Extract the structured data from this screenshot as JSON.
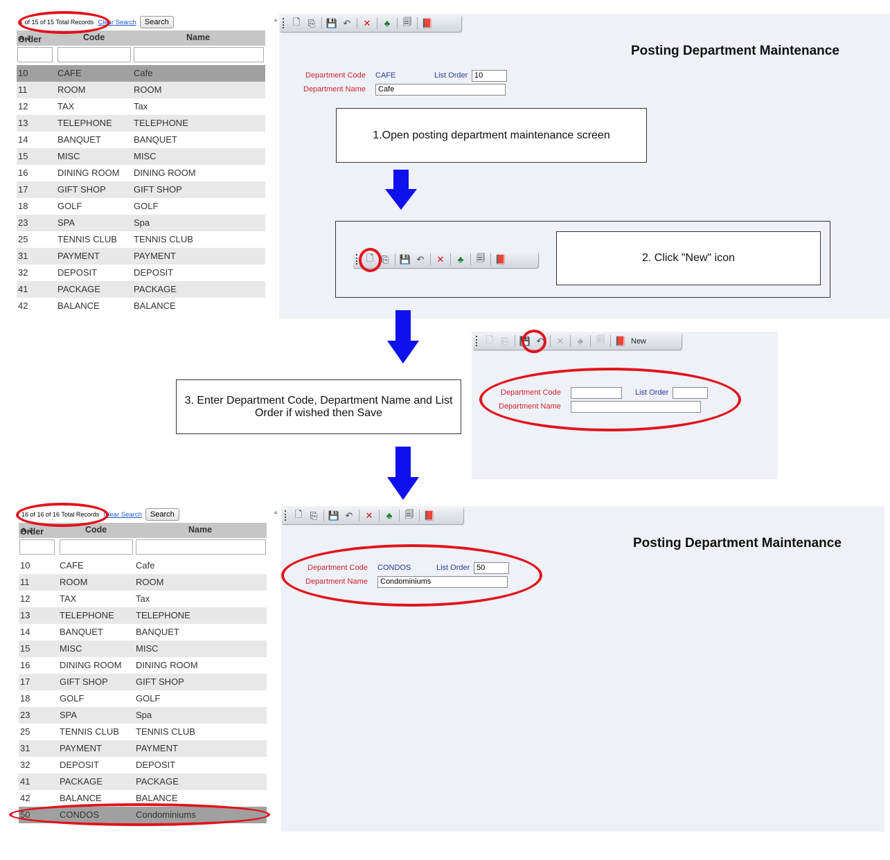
{
  "colors": {
    "annotation_red": "#e0141d",
    "arrow_blue": "#1010ee",
    "label_red": "#d2232a",
    "label_blue": "#2b3a9a",
    "panel_bg": "#eef1f8"
  },
  "toolbar_icons": [
    "new-icon",
    "copy-icon",
    "save-icon",
    "undo-icon",
    "delete-icon",
    "tree-icon",
    "print-icon",
    "book-icon"
  ],
  "grid1": {
    "record_count": "1 of 15 of 15 Total Records",
    "clear_search": "Clear Search",
    "search": "Search",
    "headers": {
      "order": "Order",
      "code": "Code",
      "name": "Name"
    },
    "rows": [
      {
        "order": "10",
        "code": "CAFE",
        "name": "Cafe"
      },
      {
        "order": "11",
        "code": "ROOM",
        "name": "ROOM"
      },
      {
        "order": "12",
        "code": "TAX",
        "name": "Tax"
      },
      {
        "order": "13",
        "code": "TELEPHONE",
        "name": "TELEPHONE"
      },
      {
        "order": "14",
        "code": "BANQUET",
        "name": "BANQUET"
      },
      {
        "order": "15",
        "code": "MISC",
        "name": "MISC"
      },
      {
        "order": "16",
        "code": "DINING ROOM",
        "name": "DINING ROOM"
      },
      {
        "order": "17",
        "code": "GIFT SHOP",
        "name": "GIFT SHOP"
      },
      {
        "order": "18",
        "code": "GOLF",
        "name": "GOLF"
      },
      {
        "order": "23",
        "code": "SPA",
        "name": "Spa"
      },
      {
        "order": "25",
        "code": "TENNIS CLUB",
        "name": "TENNIS CLUB"
      },
      {
        "order": "31",
        "code": "PAYMENT",
        "name": "PAYMENT"
      },
      {
        "order": "32",
        "code": "DEPOSIT",
        "name": "DEPOSIT"
      },
      {
        "order": "41",
        "code": "PACKAGE",
        "name": "PACKAGE"
      },
      {
        "order": "42",
        "code": "BALANCE",
        "name": "BALANCE"
      }
    ]
  },
  "form1": {
    "title": "Posting Department Maintenance",
    "dept_code_label": "Department Code",
    "dept_code_value": "CAFE",
    "list_order_label": "List Order",
    "list_order_value": "10",
    "dept_name_label": "Department Name",
    "dept_name_value": "Cafe"
  },
  "steps": {
    "step1": "1.Open posting department maintenance screen",
    "step2": "2. Click \"New\" icon",
    "step3": "3. Enter Department Code, Department Name and List Order if wished then Save"
  },
  "form2": {
    "new_label": "New",
    "dept_code_label": "Department Code",
    "list_order_label": "List Order",
    "dept_name_label": "Department Name"
  },
  "grid2": {
    "record_count": "16 of 16 of 16 Total Records",
    "clear_search": "Clear Search",
    "search": "Search",
    "headers": {
      "order": "Order",
      "code": "Code",
      "name": "Name"
    },
    "rows": [
      {
        "order": "10",
        "code": "CAFE",
        "name": "Cafe"
      },
      {
        "order": "11",
        "code": "ROOM",
        "name": "ROOM"
      },
      {
        "order": "12",
        "code": "TAX",
        "name": "Tax"
      },
      {
        "order": "13",
        "code": "TELEPHONE",
        "name": "TELEPHONE"
      },
      {
        "order": "14",
        "code": "BANQUET",
        "name": "BANQUET"
      },
      {
        "order": "15",
        "code": "MISC",
        "name": "MISC"
      },
      {
        "order": "16",
        "code": "DINING ROOM",
        "name": "DINING ROOM"
      },
      {
        "order": "17",
        "code": "GIFT SHOP",
        "name": "GIFT SHOP"
      },
      {
        "order": "18",
        "code": "GOLF",
        "name": "GOLF"
      },
      {
        "order": "23",
        "code": "SPA",
        "name": "Spa"
      },
      {
        "order": "25",
        "code": "TENNIS CLUB",
        "name": "TENNIS CLUB"
      },
      {
        "order": "31",
        "code": "PAYMENT",
        "name": "PAYMENT"
      },
      {
        "order": "32",
        "code": "DEPOSIT",
        "name": "DEPOSIT"
      },
      {
        "order": "41",
        "code": "PACKAGE",
        "name": "PACKAGE"
      },
      {
        "order": "42",
        "code": "BALANCE",
        "name": "BALANCE"
      },
      {
        "order": "50",
        "code": "CONDOS",
        "name": "Condominiums"
      }
    ]
  },
  "form3": {
    "title": "Posting Department Maintenance",
    "dept_code_label": "Department Code",
    "dept_code_value": "CONDOS",
    "list_order_label": "List Order",
    "list_order_value": "50",
    "dept_name_label": "Department Name",
    "dept_name_value": "Condominiums"
  }
}
